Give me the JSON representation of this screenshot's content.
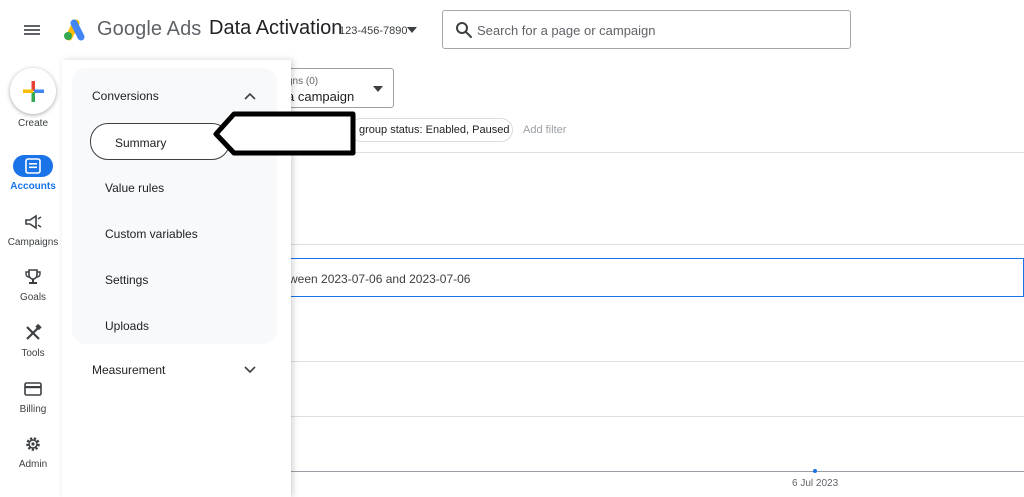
{
  "header": {
    "brand": "Google Ads",
    "account_name": "Data Activation",
    "account_id": "123-456-7890",
    "search_placeholder": "Search for a page or campaign"
  },
  "rail": {
    "create_label": "Create",
    "items": [
      {
        "label": "Accounts",
        "icon": "accounts-icon",
        "active": true
      },
      {
        "label": "Campaigns",
        "icon": "megaphone-icon"
      },
      {
        "label": "Goals",
        "icon": "trophy-icon"
      },
      {
        "label": "Tools",
        "icon": "tools-icon"
      },
      {
        "label": "Billing",
        "icon": "credit-card-icon"
      },
      {
        "label": "Admin",
        "icon": "gear-icon"
      }
    ]
  },
  "nav": {
    "conversions": {
      "title": "Conversions",
      "items": [
        "Summary",
        "Value rules",
        "Custom variables",
        "Settings",
        "Uploads"
      ],
      "active": "Summary"
    },
    "measurement": {
      "title": "Measurement"
    }
  },
  "main": {
    "campaign_dropdown_small": "gns (0)",
    "campaign_dropdown_big": "a campaign",
    "filter_chip": "group status: Enabled, Paused",
    "add_filter": "Add filter",
    "date_row_text": "ween 2023-07-06 and 2023-07-06",
    "axis_label": "6 Jul 2023"
  },
  "colors": {
    "accent": "#1a73e8",
    "text": "#202124",
    "muted": "#5f6368"
  }
}
